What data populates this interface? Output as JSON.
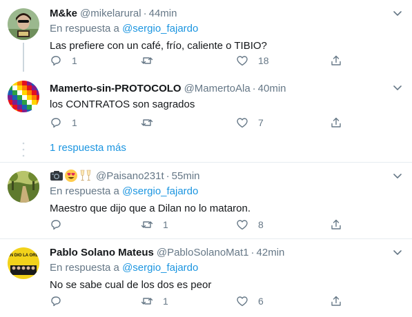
{
  "tweets": [
    {
      "name": "M&ke",
      "handle": "@mikelarural",
      "time": "44min",
      "reply_prefix": "En respuesta a",
      "reply_mention": "@sergio_fajardo",
      "text": "Las prefiere con un café, frío, caliente o TIBIO?",
      "replies": "1",
      "retweets": "",
      "likes": "18"
    },
    {
      "name": "Mamerto-sin-PROTOCOLO",
      "handle": "@MamertoAla",
      "time": "40min",
      "text": "los CONTRATOS son sagrados",
      "replies": "1",
      "retweets": "",
      "likes": "7"
    },
    {
      "name": "",
      "name_emojis": [
        "camera",
        "heart-eyes-face",
        "champagne-glasses"
      ],
      "handle": "@Paisano231t",
      "time": "55min",
      "reply_prefix": "En respuesta a",
      "reply_mention": "@sergio_fajardo",
      "text": "Maestro que dijo que a Dilan no lo mataron.",
      "replies": "",
      "retweets": "1",
      "likes": "8"
    },
    {
      "name": "Pablo Solano Mateus",
      "handle": "@PabloSolanoMat1",
      "time": "42min",
      "reply_prefix": "En respuesta a",
      "reply_mention": "@sergio_fajardo",
      "text": "No se sabe cual de los dos es peor",
      "replies": "",
      "retweets": "1",
      "likes": "6"
    }
  ],
  "thread": {
    "more_replies": "1 respuesta más"
  },
  "avatar_text": {
    "poster": "QUIÉN DIO LA ORDEN?"
  },
  "colors": {
    "link": "#1b95e0",
    "secondary": "#657786",
    "divider": "#e6ecf0",
    "thread_line": "#ccd6dd",
    "primary_text": "#14171a"
  },
  "icons": [
    "reply-icon",
    "retweet-icon",
    "like-icon",
    "share-icon",
    "caret-down-icon"
  ]
}
